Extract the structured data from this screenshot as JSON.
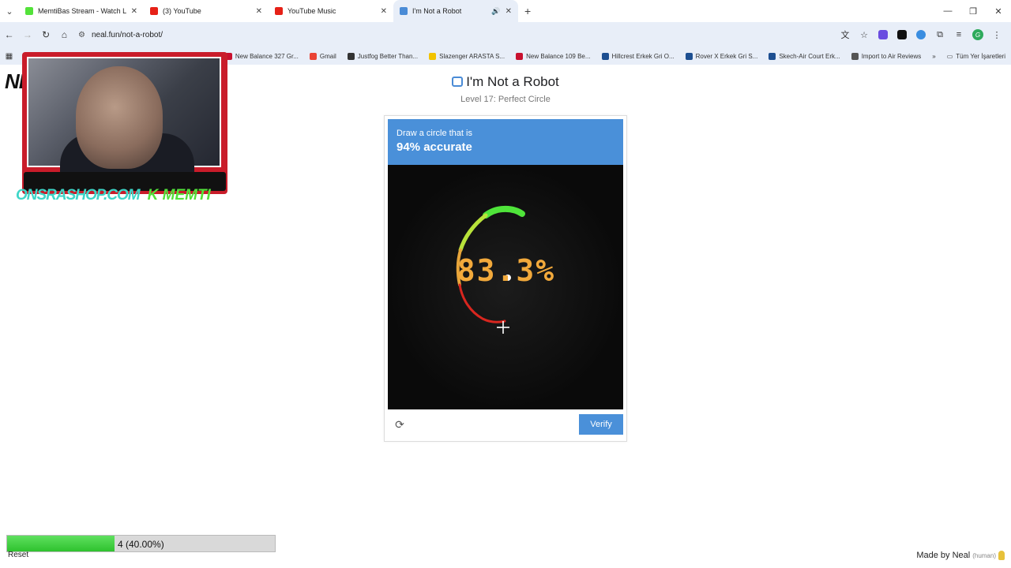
{
  "tabs": [
    {
      "title": "MemtiBas Stream - Watch Live",
      "color": "#53e23a",
      "active": false
    },
    {
      "title": "(3) YouTube",
      "color": "#e62117",
      "active": false
    },
    {
      "title": "YouTube Music",
      "color": "#e62117",
      "active": false
    },
    {
      "title": "I'm Not a Robot",
      "color": "#4a8bd6",
      "active": true
    }
  ],
  "address": {
    "url": "neal.fun/not-a-robot/"
  },
  "bookmarks": [
    {
      "label": "New Balance 327 Gr...",
      "color": "#c8102e"
    },
    {
      "label": "Gmail",
      "color": "#ea4335"
    },
    {
      "label": "Justfog Better Than...",
      "color": "#333333"
    },
    {
      "label": "Slazenger ARASTA S...",
      "color": "#f2c300"
    },
    {
      "label": "New Balance 109 Be...",
      "color": "#c8102e"
    },
    {
      "label": "Hillcrest Erkek Gri O...",
      "color": "#1d4f91"
    },
    {
      "label": "Rover X Erkek Gri S...",
      "color": "#1d4f91"
    },
    {
      "label": "Skech-Air Court Erk...",
      "color": "#1d4f91"
    },
    {
      "label": "Import to Air Reviews",
      "color": "#555555"
    }
  ],
  "bookmarks_all": "Tüm Yer İşaretleri",
  "page": {
    "logo_partial": "NE",
    "title": "I'm Not a Robot",
    "subtitle": "Level 17: Perfect Circle",
    "instruction": "Draw a circle that is",
    "target": "94% accurate",
    "score": "83.3%",
    "verify_label": "Verify"
  },
  "overlay": {
    "brand_left": "ONSRASHOP.COM",
    "brand_right": "K MEMTI"
  },
  "progress": {
    "label": "4 (40.00%)",
    "fraction": 0.4
  },
  "reset_label": "Reset",
  "made_by": "Made by Neal",
  "made_by_note": "(human)"
}
